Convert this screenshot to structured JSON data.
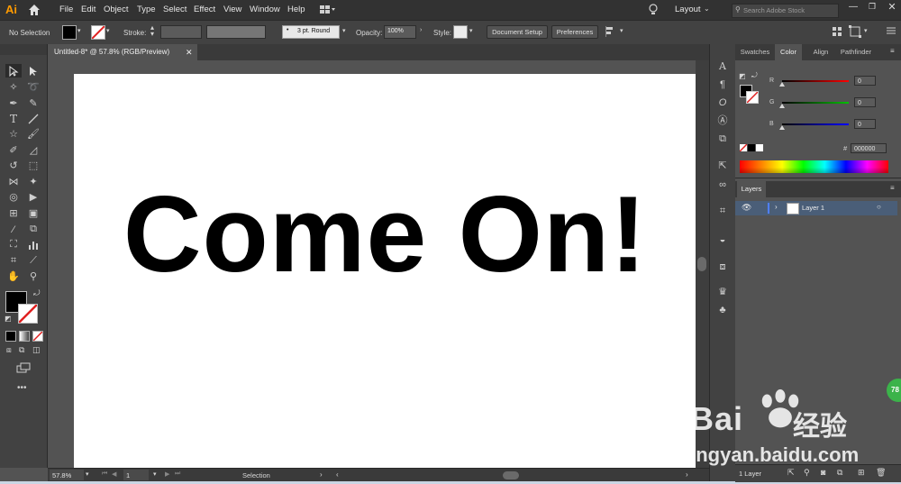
{
  "app": {
    "logo_text": "Ai"
  },
  "menu": {
    "items": [
      "File",
      "Edit",
      "Object",
      "Type",
      "Select",
      "Effect",
      "View",
      "Window",
      "Help"
    ],
    "workspace_label": "Layout",
    "search_placeholder": "Search Adobe Stock"
  },
  "control": {
    "selection_label": "No Selection",
    "stroke_label": "Stroke:",
    "brush_label": "3 pt. Round",
    "opacity_label": "Opacity:",
    "opacity_value": "100%",
    "style_label": "Style:",
    "document_setup_label": "Document Setup",
    "preferences_label": "Preferences"
  },
  "document": {
    "tab_title": "Untitled-8* @ 57.8% (RGB/Preview)",
    "headline": "Come On!"
  },
  "status": {
    "zoom": "57.8%",
    "artboard_number": "1",
    "tool_name": "Selection"
  },
  "color_panel": {
    "tabs": [
      "Swatches",
      "Color",
      "Align",
      "Pathfinder"
    ],
    "active_tab": "Color",
    "channels": [
      {
        "label": "R",
        "value": "0",
        "color": "#ff0000"
      },
      {
        "label": "G",
        "value": "0",
        "color": "#00c000"
      },
      {
        "label": "B",
        "value": "0",
        "color": "#0000ff"
      }
    ],
    "hex_label": "#",
    "hex_value": "000000"
  },
  "layers_panel": {
    "tab_label": "Layers",
    "layers": [
      {
        "name": "Layer 1",
        "visible": true
      }
    ],
    "footer_count": "1 Layer"
  },
  "watermark": {
    "brand": "Bai",
    "brand_suffix": "经验",
    "url": "jingyan.baidu.com",
    "badge": "78"
  },
  "colors": {
    "accent_logo": "#ff9a00",
    "fill": "#000000",
    "layer_highlight": "#4a5e78"
  }
}
